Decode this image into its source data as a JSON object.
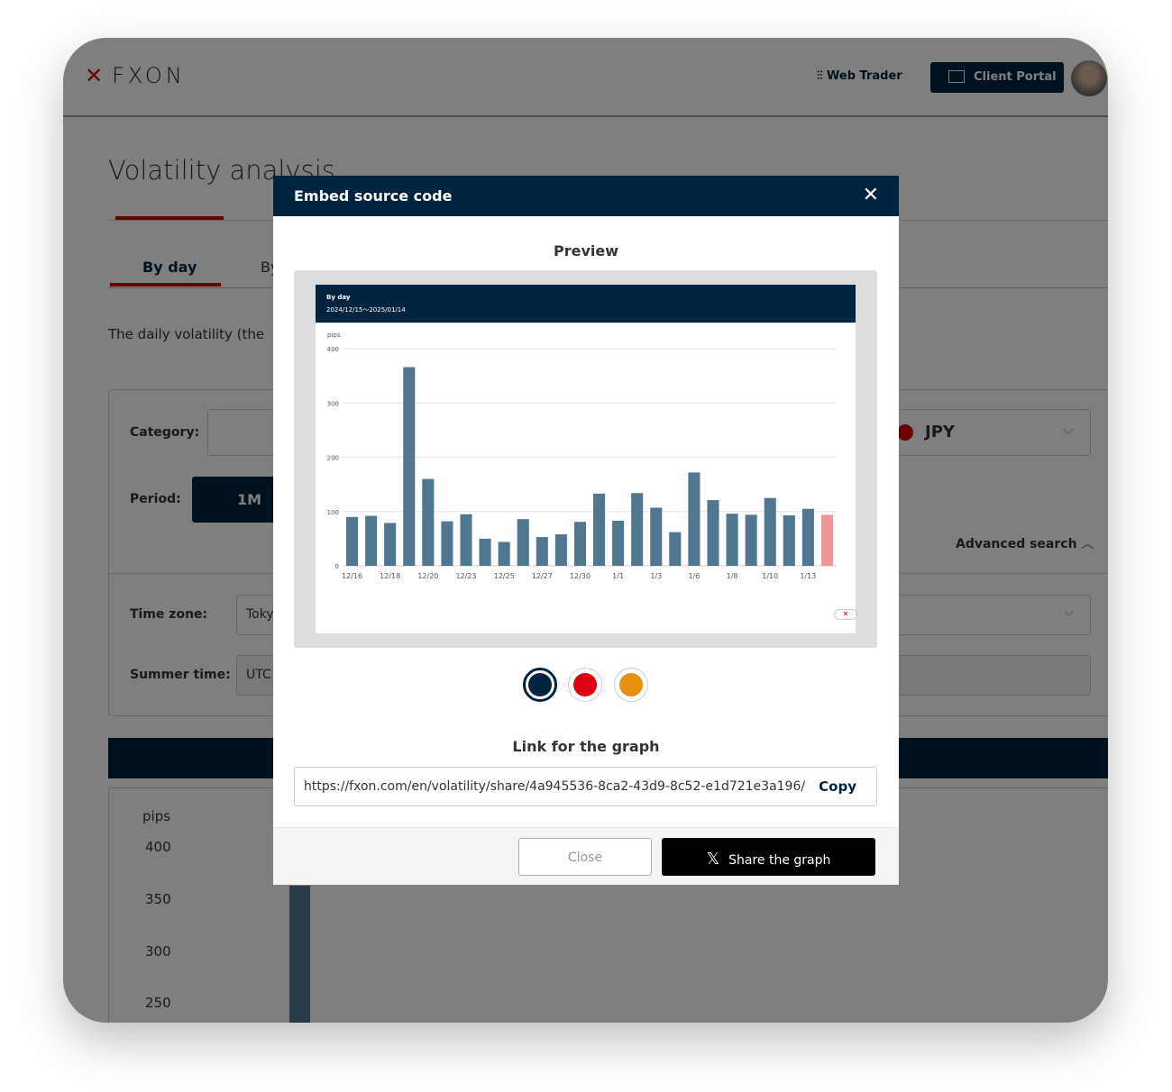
{
  "header": {
    "logo": "FXON",
    "web_trader": "Web Trader",
    "client_portal": "Client Portal"
  },
  "page": {
    "title": "Volatility analysis",
    "tabs": [
      "By day",
      "By"
    ],
    "description": "The daily volatility (the",
    "category_label": "Category:",
    "currency": "JPY",
    "period_label": "Period:",
    "period_selected": "1M",
    "advanced_search": "Advanced search",
    "timezone_label": "Time zone:",
    "timezone_value": "Toky",
    "summer_label": "Summer time:",
    "summer_value": "UTC",
    "bg_chart": {
      "unit": "pips",
      "y_ticks": [
        400,
        350,
        300,
        250
      ]
    }
  },
  "modal": {
    "title": "Embed source code",
    "preview_title": "Preview",
    "link_title": "Link for the graph",
    "link": "https://fxon.com/en/volatility/share/4a945536-8ca2-43d9-8c52-e1d721e3a196/",
    "copy": "Copy",
    "close": "Close",
    "share": "Share the graph",
    "colors": [
      {
        "name": "navy",
        "hex": "#00243f",
        "selected": true
      },
      {
        "name": "red",
        "hex": "#e00012",
        "selected": false
      },
      {
        "name": "orange",
        "hex": "#e8900f",
        "selected": false
      }
    ]
  },
  "chart_data": {
    "type": "bar",
    "title": "By day",
    "subtitle": "2024/12/15～2025/01/14",
    "ylabel": "pips",
    "ylim": [
      0,
      400
    ],
    "y_ticks": [
      0,
      100,
      200,
      300,
      400
    ],
    "x_tick_labels": [
      "12/16",
      "12/18",
      "12/20",
      "12/23",
      "12/25",
      "12/27",
      "12/30",
      "1/1",
      "1/3",
      "1/6",
      "1/8",
      "1/10",
      "1/13"
    ],
    "values": [
      90,
      92,
      79,
      366,
      160,
      82,
      95,
      50,
      44,
      86,
      53,
      58,
      81,
      133,
      83,
      134,
      107,
      62,
      172,
      121,
      96,
      94,
      125,
      93,
      105,
      94
    ],
    "bar_color": "#51768f",
    "highlight_color": "#f19599",
    "highlight_last": true,
    "grid": true
  }
}
